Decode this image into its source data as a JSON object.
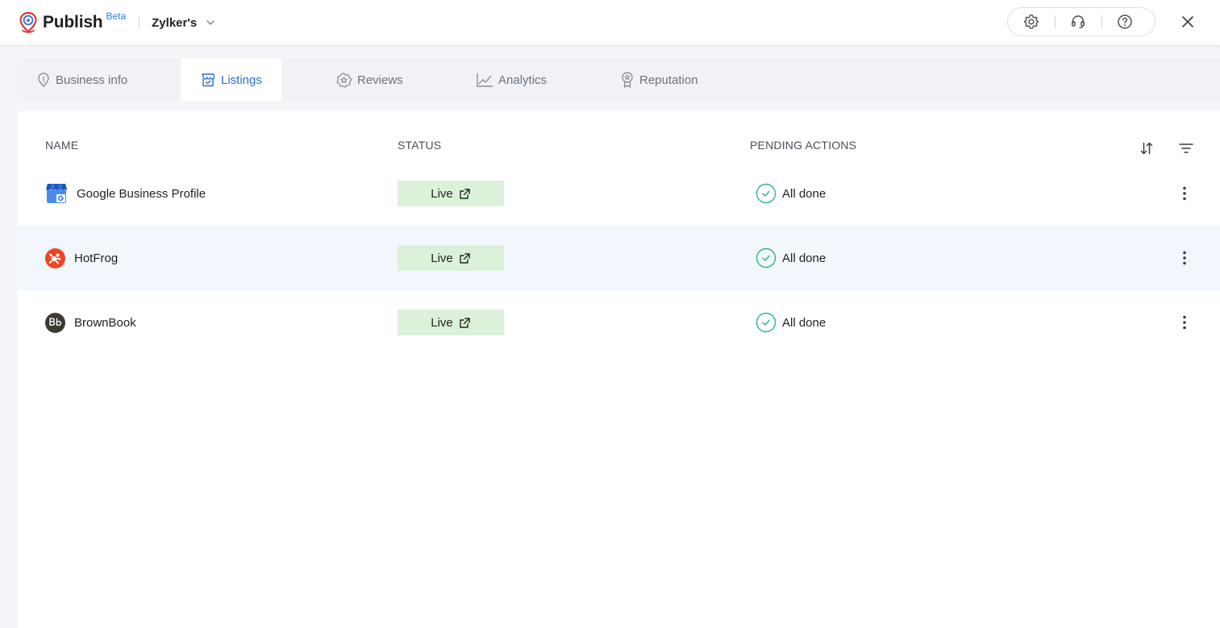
{
  "app": {
    "name": "Publish",
    "badge": "Beta",
    "organization": "Zylker's"
  },
  "header_tools": [
    {
      "icon": "gear-icon"
    },
    {
      "icon": "headset-icon"
    },
    {
      "icon": "help-icon"
    }
  ],
  "tabs": [
    {
      "label": "Business info",
      "icon": "location-pin-icon",
      "active": false
    },
    {
      "label": "Listings",
      "icon": "storefront-icon",
      "active": true
    },
    {
      "label": "Reviews",
      "icon": "star-badge-icon",
      "active": false
    },
    {
      "label": "Analytics",
      "icon": "line-chart-icon",
      "active": false
    },
    {
      "label": "Reputation",
      "icon": "award-icon",
      "active": false
    }
  ],
  "table": {
    "columns": [
      "NAME",
      "STATUS",
      "PENDING ACTIONS"
    ],
    "rows": [
      {
        "name": "Google Business Profile",
        "logo": "google-business-logo",
        "status": "Live",
        "pending": "All done"
      },
      {
        "name": "HotFrog",
        "logo": "hotfrog-logo",
        "status": "Live",
        "pending": "All done"
      },
      {
        "name": "BrownBook",
        "logo": "brownbook-logo",
        "status": "Live",
        "pending": "All done"
      }
    ]
  },
  "colors": {
    "accent": "#2d6fd2",
    "live_bg": "#dcf1da",
    "done_green": "#2fb58a",
    "row_highlight": "#f2f6fd",
    "brand_red": "#e0343c"
  }
}
